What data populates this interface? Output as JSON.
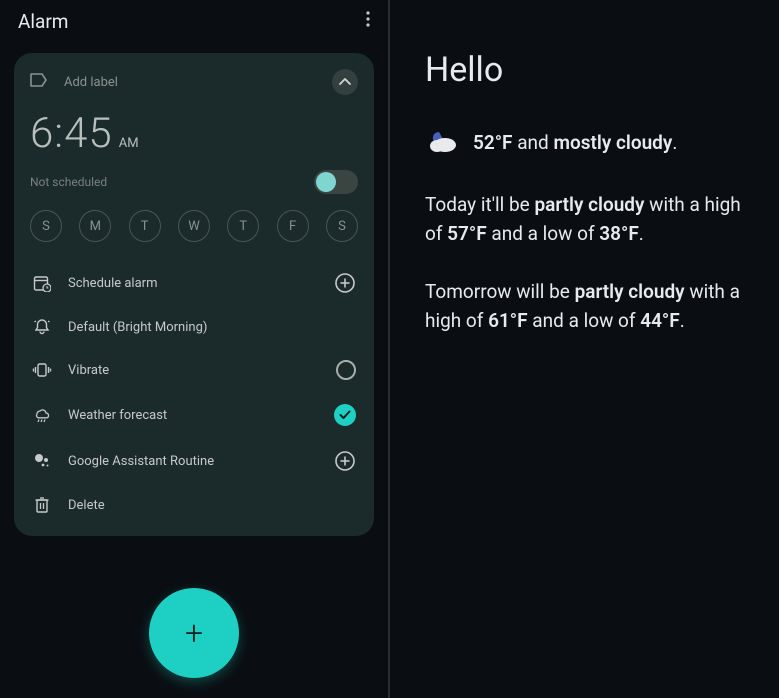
{
  "left": {
    "title": "Alarm",
    "label_placeholder": "Add label",
    "time": "6:45",
    "ampm": "AM",
    "status": "Not scheduled",
    "days": [
      "S",
      "M",
      "T",
      "W",
      "T",
      "F",
      "S"
    ],
    "options": {
      "schedule": "Schedule alarm",
      "sound": "Default (Bright Morning)",
      "vibrate": "Vibrate",
      "weather": "Weather forecast",
      "assistant": "Google Assistant Routine",
      "delete": "Delete"
    }
  },
  "right": {
    "greeting": "Hello",
    "current_temp": "52°F",
    "current_join": " and ",
    "current_desc": "mostly cloudy",
    "current_end": ".",
    "today_1": "Today it'll be ",
    "today_desc": "partly cloudy",
    "today_2": " with a high of ",
    "today_high": "57°F",
    "today_3": " and a low of ",
    "today_low": "38°F",
    "today_4": ".",
    "tom_1": "Tomorrow will be ",
    "tom_desc": "partly cloudy",
    "tom_2": " with a high of ",
    "tom_high": "61°F",
    "tom_3": " and a low of ",
    "tom_low": "44°F",
    "tom_4": "."
  }
}
